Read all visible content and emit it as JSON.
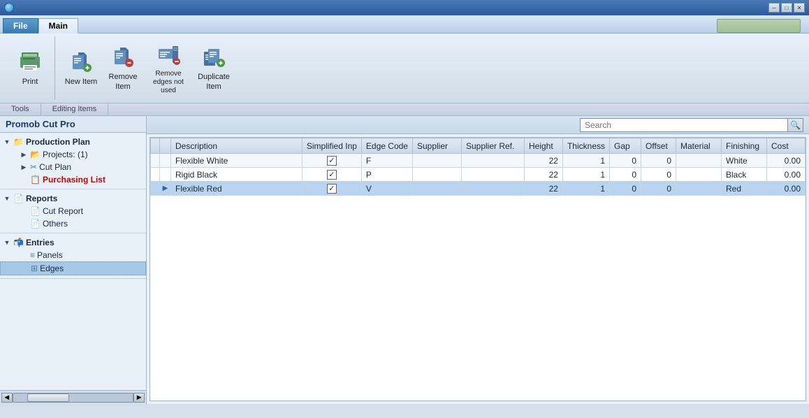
{
  "titleBar": {
    "controls": {
      "minimize": "─",
      "restore": "□",
      "close": "✕"
    }
  },
  "menuBar": {
    "tabs": [
      {
        "id": "file",
        "label": "File",
        "active": false,
        "isFile": true
      },
      {
        "id": "main",
        "label": "Main",
        "active": true,
        "isFile": false
      }
    ]
  },
  "toolbar": {
    "groups": [
      {
        "id": "tools",
        "label": "Tools",
        "buttons": [
          {
            "id": "print",
            "label": "Print"
          }
        ]
      },
      {
        "id": "editing",
        "label": "Editing Items",
        "buttons": [
          {
            "id": "new-item",
            "label": "New\nItem"
          },
          {
            "id": "remove-item",
            "label": "Remove\nItem"
          },
          {
            "id": "remove-edges",
            "label": "Remove\nedges not used"
          },
          {
            "id": "duplicate-item",
            "label": "Duplicate\nItem"
          }
        ]
      }
    ]
  },
  "sidebar": {
    "title": "Promob Cut Pro",
    "tree": {
      "productionPlan": {
        "label": "Production Plan",
        "expanded": true,
        "children": {
          "projects": {
            "label": "Projects: (1)",
            "expanded": false
          },
          "cutPlan": {
            "label": "Cut Plan",
            "expanded": false
          },
          "purchasingList": {
            "label": "Purchasing List",
            "expanded": false,
            "active": true
          }
        }
      },
      "reports": {
        "label": "Reports",
        "expanded": true,
        "children": {
          "cutReport": {
            "label": "Cut Report"
          },
          "others": {
            "label": "Others"
          }
        }
      },
      "entries": {
        "label": "Entries",
        "expanded": true,
        "children": {
          "panels": {
            "label": "Panels"
          },
          "edges": {
            "label": "Edges",
            "selected": true
          }
        }
      }
    }
  },
  "search": {
    "placeholder": "Search",
    "value": ""
  },
  "table": {
    "columns": [
      {
        "id": "indicator",
        "label": ""
      },
      {
        "id": "row-arrow",
        "label": ""
      },
      {
        "id": "description",
        "label": "Description"
      },
      {
        "id": "simplified",
        "label": "Simplified Inp"
      },
      {
        "id": "edge-code",
        "label": "Edge Code"
      },
      {
        "id": "supplier",
        "label": "Supplier"
      },
      {
        "id": "supplier-ref",
        "label": "Supplier Ref."
      },
      {
        "id": "height",
        "label": "Height"
      },
      {
        "id": "thickness",
        "label": "Thickness"
      },
      {
        "id": "gap",
        "label": "Gap"
      },
      {
        "id": "offset",
        "label": "Offset"
      },
      {
        "id": "material",
        "label": "Material"
      },
      {
        "id": "finishing",
        "label": "Finishing"
      },
      {
        "id": "cost",
        "label": "Cost"
      }
    ],
    "rows": [
      {
        "id": 1,
        "selected": false,
        "arrow": "",
        "description": "Flexible White",
        "simplified": true,
        "edgeCode": "F",
        "supplier": "",
        "supplierRef": "",
        "height": "22",
        "thickness": "1",
        "gap": "0",
        "offset": "0",
        "material": "",
        "finishing": "White",
        "cost": "0.00"
      },
      {
        "id": 2,
        "selected": false,
        "arrow": "",
        "description": "Rigid Black",
        "simplified": true,
        "edgeCode": "P",
        "supplier": "",
        "supplierRef": "",
        "height": "22",
        "thickness": "1",
        "gap": "0",
        "offset": "0",
        "material": "",
        "finishing": "Black",
        "cost": "0.00"
      },
      {
        "id": 3,
        "selected": true,
        "arrow": "▶",
        "description": "Flexible Red",
        "simplified": true,
        "edgeCode": "V",
        "supplier": "",
        "supplierRef": "",
        "height": "22",
        "thickness": "1",
        "gap": "0",
        "offset": "0",
        "material": "",
        "finishing": "Red",
        "cost": "0.00"
      }
    ]
  },
  "scrollbar": {
    "arrow_left": "◀",
    "arrow_right": "▶"
  }
}
